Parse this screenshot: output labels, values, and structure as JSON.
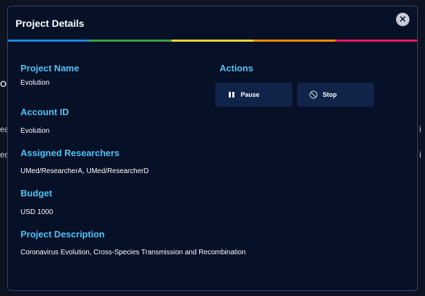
{
  "background": {
    "fragments": [
      "OI",
      "ea",
      "ec"
    ]
  },
  "modal": {
    "title": "Project Details",
    "close_label": "×",
    "rainbow_colors": [
      "#1e88e5",
      "#43a047",
      "#fdd835",
      "#fb8c00",
      "#e91e63"
    ]
  },
  "fields": {
    "project_name_label": "Project Name",
    "project_name_value": "Evolution",
    "account_id_label": "Account ID",
    "account_id_value": "Evolution",
    "researchers_label": "Assigned Researchers",
    "researchers_value": "UMed/ResearcherA, UMed/ResearcherD",
    "budget_label": "Budget",
    "budget_value": "USD 1000",
    "description_label": "Project Description",
    "description_value": "Coronavirus Evolution, Cross-Species Transmission and Recombination"
  },
  "actions": {
    "heading": "Actions",
    "pause_label": "Pause",
    "pause_icon": "pause-icon",
    "stop_label": "Stop",
    "stop_icon": "stop-icon"
  },
  "colors": {
    "accent": "#4fc3f7",
    "modal_bg": "#061027",
    "button_bg": "#0f2448"
  }
}
